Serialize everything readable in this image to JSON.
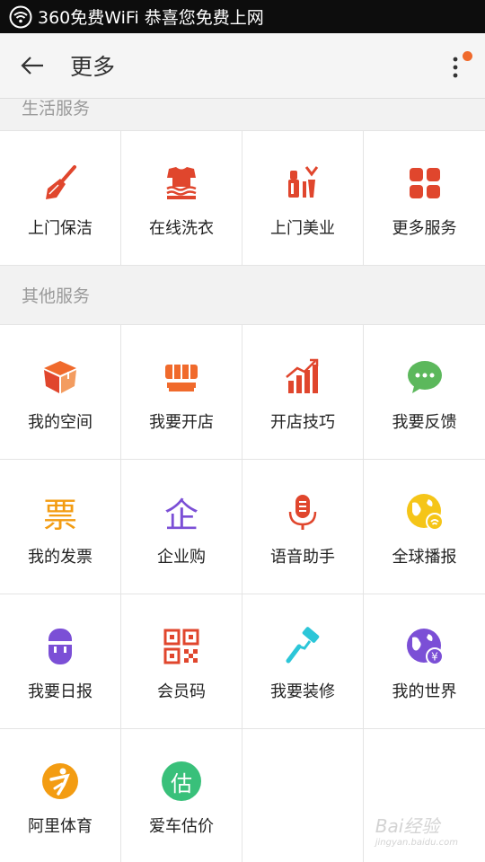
{
  "status_bar": {
    "text": "360免费WiFi 恭喜您免费上网"
  },
  "app_bar": {
    "title": "更多"
  },
  "sections": [
    {
      "title": "生活服务",
      "items": [
        {
          "label": "上门保洁",
          "icon": "broom-icon"
        },
        {
          "label": "在线洗衣",
          "icon": "laundry-icon"
        },
        {
          "label": "上门美业",
          "icon": "beauty-icon"
        },
        {
          "label": "更多服务",
          "icon": "grid-icon"
        }
      ]
    },
    {
      "title": "其他服务",
      "items": [
        {
          "label": "我的空间",
          "icon": "cube-icon"
        },
        {
          "label": "我要开店",
          "icon": "shop-icon"
        },
        {
          "label": "开店技巧",
          "icon": "growth-chart-icon"
        },
        {
          "label": "我要反馈",
          "icon": "chat-bubble-icon"
        },
        {
          "label": "我的发票",
          "icon": "invoice-icon",
          "glyph": "票"
        },
        {
          "label": "企业购",
          "icon": "enterprise-icon",
          "glyph": "企"
        },
        {
          "label": "语音助手",
          "icon": "microphone-icon"
        },
        {
          "label": "全球播报",
          "icon": "globe-broadcast-icon"
        },
        {
          "label": "我要日报",
          "icon": "daily-report-icon"
        },
        {
          "label": "会员码",
          "icon": "qr-code-icon"
        },
        {
          "label": "我要装修",
          "icon": "paint-roller-icon"
        },
        {
          "label": "我的世界",
          "icon": "world-yuan-icon",
          "glyph": "¥"
        },
        {
          "label": "阿里体育",
          "icon": "sports-icon"
        },
        {
          "label": "爱车估价",
          "icon": "car-valuation-icon",
          "glyph": "估"
        }
      ]
    }
  ],
  "watermark": {
    "brand": "Bai经验",
    "domain": "jingyan.baidu.com"
  },
  "colors": {
    "accent": "#f06a2c",
    "red": "#e0462d",
    "purple": "#7b4fd6",
    "green": "#39c07a",
    "cyan": "#2cc6d8",
    "yellow": "#f5c518",
    "orange": "#f39c12"
  }
}
